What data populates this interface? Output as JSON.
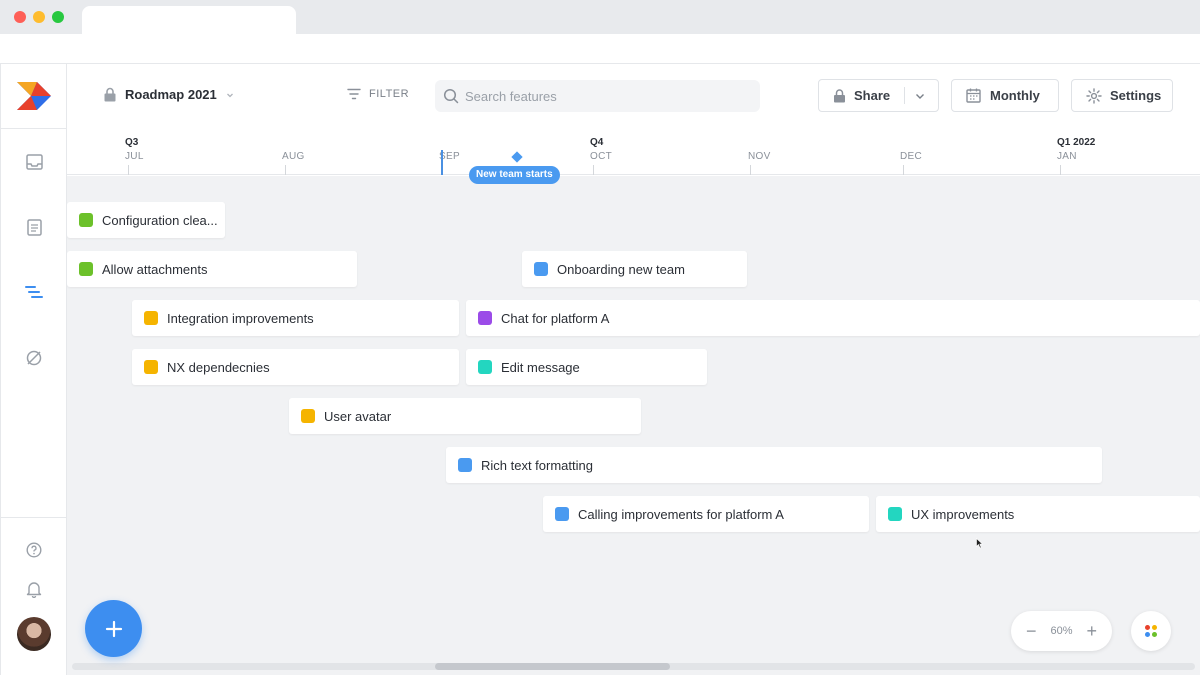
{
  "header": {
    "roadmap_name": "Roadmap 2021",
    "filter_label": "FILTER",
    "search_placeholder": "Search features",
    "share_label": "Share",
    "monthly_label": "Monthly",
    "settings_label": "Settings"
  },
  "timeline": {
    "quarters": [
      "Q3",
      "Q4",
      "Q1 2022"
    ],
    "months": [
      "JUL",
      "AUG",
      "SEP",
      "OCT",
      "NOV",
      "DEC",
      "JAN"
    ],
    "milestone": "New team starts"
  },
  "features": [
    {
      "label": "Configuration clea...",
      "color": "#6cc12a"
    },
    {
      "label": "Allow attachments",
      "color": "#6cc12a"
    },
    {
      "label": "Onboarding new team",
      "color": "#4a9af0"
    },
    {
      "label": "Integration improvements",
      "color": "#f5b400"
    },
    {
      "label": "Chat for platform A",
      "color": "#9b4be8"
    },
    {
      "label": "NX dependecnies",
      "color": "#f5b400"
    },
    {
      "label": "Edit message",
      "color": "#23d6c0"
    },
    {
      "label": "User avatar",
      "color": "#f5b400"
    },
    {
      "label": "Rich text formatting",
      "color": "#4a9af0"
    },
    {
      "label": "Calling improvements for platform A",
      "color": "#4a9af0"
    },
    {
      "label": "UX improvements",
      "color": "#23d6c0"
    }
  ],
  "zoom": {
    "level": "60%"
  },
  "sidebar": {
    "icons": [
      "inbox-icon",
      "document-icon",
      "roadmap-icon",
      "hidden-icon",
      "help-icon",
      "bell-icon"
    ]
  },
  "colors": {
    "accent": "#3d8ef0",
    "canvas": "#f1f2f4"
  }
}
